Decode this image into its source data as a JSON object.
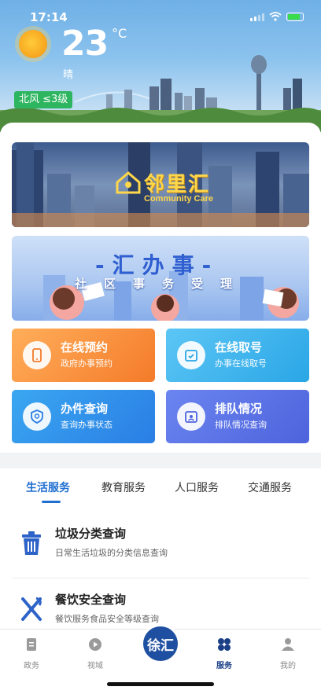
{
  "status_bar": {
    "time": "17:14"
  },
  "weather": {
    "temperature": "23",
    "unit": "°C",
    "condition": "晴",
    "wind": "北风 ≤3级"
  },
  "banners": {
    "community": {
      "title": "邻里汇",
      "subtitle": "Community Care"
    },
    "affairs": {
      "title": "-汇办事-",
      "subtitle": "社区事务受理"
    }
  },
  "services": [
    {
      "title": "在线预约",
      "desc": "政府办事预约",
      "icon": "phone-icon"
    },
    {
      "title": "在线取号",
      "desc": "办事在线取号",
      "icon": "calendar-check-icon"
    },
    {
      "title": "办件查询",
      "desc": "查询办事状态",
      "icon": "search-shield-icon"
    },
    {
      "title": "排队情况",
      "desc": "排队情况查询",
      "icon": "calendar-person-icon"
    }
  ],
  "life_tabs": [
    "生活服务",
    "教育服务",
    "人口服务",
    "交通服务"
  ],
  "life_items": [
    {
      "title": "垃圾分类查询",
      "desc": "日常生活垃圾的分类信息查询",
      "icon": "trash-icon"
    },
    {
      "title": "餐饮安全查询",
      "desc": "餐饮服务食品安全等级查询",
      "icon": "fork-knife-icon"
    }
  ],
  "tabbar": [
    {
      "label": "政务",
      "icon": "document-icon"
    },
    {
      "label": "视域",
      "icon": "play-icon"
    },
    {
      "label": "徐汇",
      "icon": "logo-icon"
    },
    {
      "label": "服务",
      "icon": "grid-icon"
    },
    {
      "label": "我的",
      "icon": "person-icon"
    }
  ],
  "colors": {
    "accent": "#1f6fd1",
    "wind_badge": "#2eb560",
    "tabbar_active": "#1a3f86"
  }
}
